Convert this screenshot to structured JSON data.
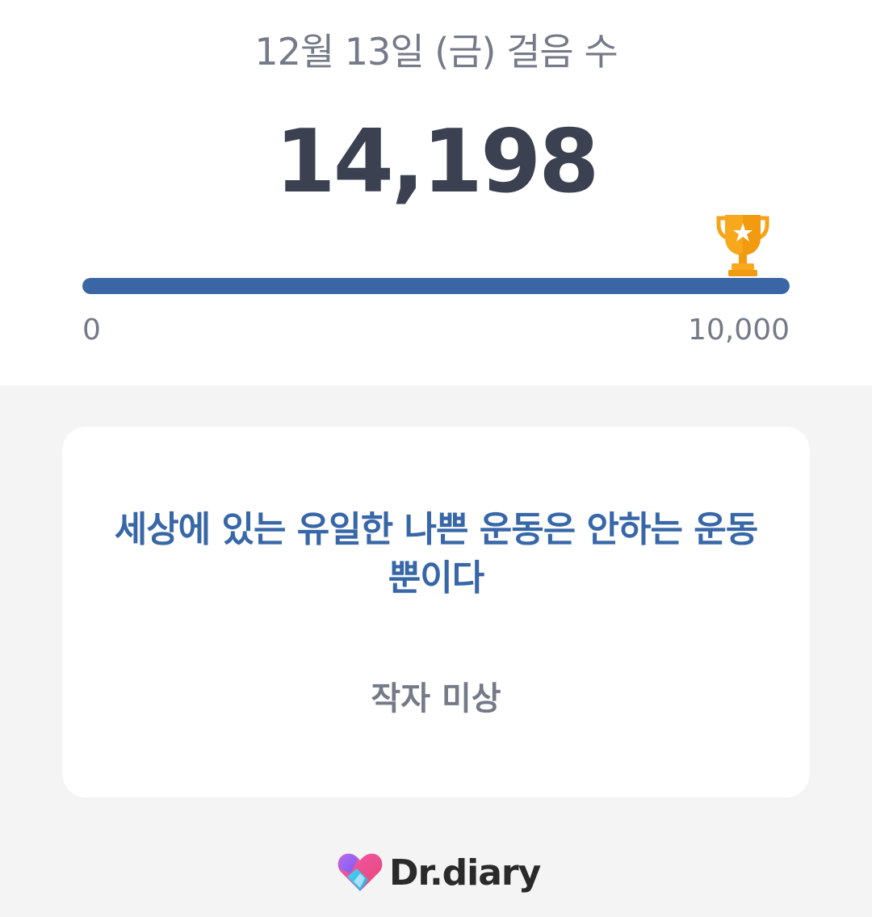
{
  "header": {
    "date_title": "12월 13일 (금) 걸음 수",
    "step_count": "14,198"
  },
  "progress": {
    "min_label": "0",
    "max_label": "10,000",
    "fill_fraction": 1.0,
    "track_color": "#3a66a6",
    "goal_icon": "trophy-star-icon"
  },
  "quote_card": {
    "quote": "세상에 있는 유일한 나쁜 운동은 안하는 운동 뿐이다",
    "author": "작자 미상",
    "quote_color": "#3867a8"
  },
  "footer": {
    "brand_name": "Dr.diary",
    "brand_icon": "heart-logo-icon"
  }
}
